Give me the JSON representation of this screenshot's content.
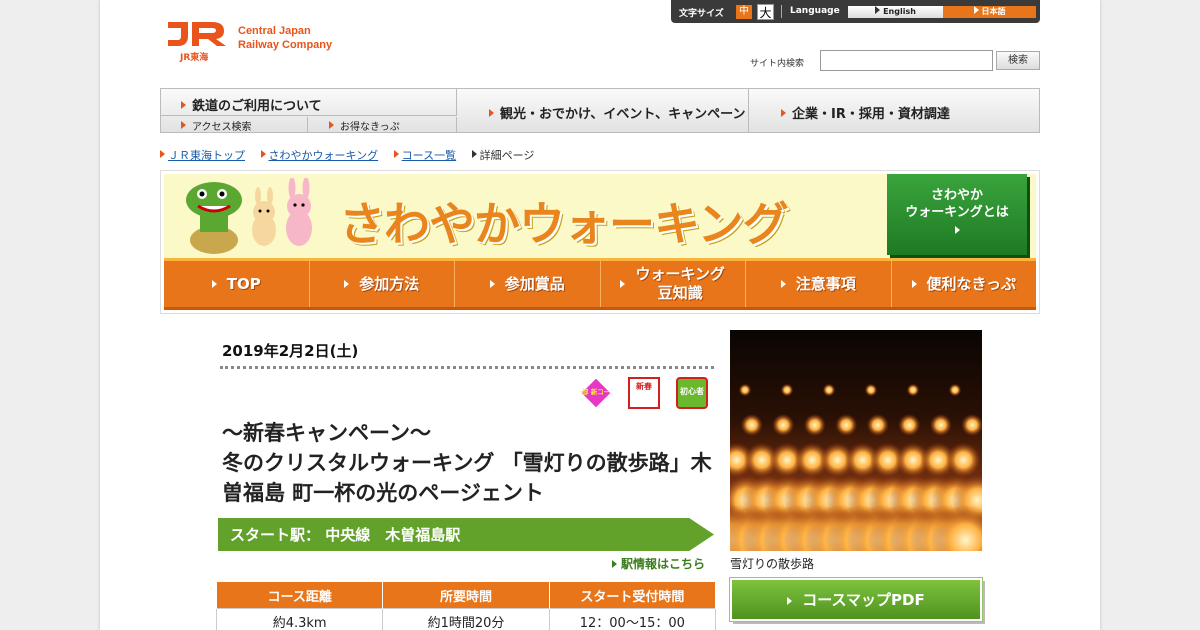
{
  "header": {
    "logo_sub": "JR東海",
    "logo_line1": "Central Japan",
    "logo_line2": "Railway Company",
    "font_size_label": "文字サイズ",
    "font_size_mid": "中",
    "font_size_large": "大",
    "language_label": "Language",
    "lang_english": "English",
    "lang_japanese": "日本語",
    "search_label": "サイト内検索",
    "search_value": "",
    "search_button": "検索"
  },
  "global_nav": {
    "item1": "鉄道のご利用について",
    "item1_sub1": "アクセス検索",
    "item1_sub2": "お得なきっぷ",
    "item2": "観光・おでかけ、イベント、キャンペーン",
    "item3": "企業・IR・採用・資材調達"
  },
  "breadcrumb": {
    "items": [
      "ＪＲ東海トップ",
      "さわやかウォーキング",
      "コース一覧"
    ],
    "current": "詳細ページ"
  },
  "banner": {
    "title": "さわやかウォーキング",
    "about_line1": "さわやか",
    "about_line2": "ウォーキングとは",
    "nav": [
      {
        "label": "TOP"
      },
      {
        "label": "参加方法"
      },
      {
        "label": "参加賞品"
      },
      {
        "label_line1": "ウォーキング",
        "label_line2": "豆知識"
      },
      {
        "label": "注意事項"
      },
      {
        "label": "便利なきっぷ"
      }
    ]
  },
  "course": {
    "date": "2019年2月2日(土)",
    "badge1": "一部 新コース",
    "badge2": "新春",
    "badge3": "初心者向",
    "title_line1": "～新春キャンペーン～",
    "title_line2": "冬のクリスタルウォーキング 「雪灯りの散歩路」木曽福島 町一杯の光のページェント",
    "start_station": "スタート駅： 中央線　木曽福島駅",
    "station_info": "駅情報はこちら",
    "table_headers": [
      "コース距離",
      "所要時間",
      "スタート受付時間"
    ],
    "table_values": [
      "約4.3km",
      "約1時間20分",
      "12：00～15：00"
    ],
    "photo_caption": "雪灯りの散歩路",
    "map_button": "コースマップPDF"
  },
  "colors": {
    "brand_orange": "#e8751a",
    "green": "#62a22a",
    "banner_yellow": "#fcf9c9"
  }
}
